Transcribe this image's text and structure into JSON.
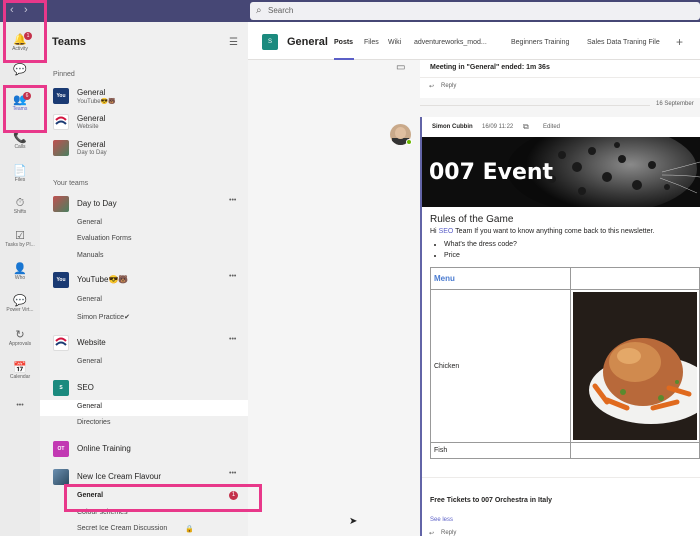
{
  "titlebar": {
    "search_placeholder": "Search",
    "back_glyph": "‹",
    "forward_glyph": "›"
  },
  "rail": [
    {
      "label": "Activity",
      "icon": "bell-icon",
      "glyph": "🔔",
      "badge": "1"
    },
    {
      "label": "",
      "icon": "chat-icon",
      "glyph": "💬"
    },
    {
      "label": "Teams",
      "icon": "teams-icon",
      "glyph": "👥",
      "badge": "6"
    },
    {
      "label": "Calls",
      "icon": "phone-icon",
      "glyph": "📞"
    },
    {
      "label": "Files",
      "icon": "file-icon",
      "glyph": "📄"
    },
    {
      "label": "Shifts",
      "icon": "clock-icon",
      "glyph": "⏱"
    },
    {
      "label": "Tasks by Pl...",
      "icon": "tasks-icon",
      "glyph": "☑"
    },
    {
      "label": "Who",
      "icon": "who-icon",
      "glyph": "👤"
    },
    {
      "label": "Power Virt...",
      "icon": "power-virtual-icon",
      "glyph": "💬"
    },
    {
      "label": "Approvals",
      "icon": "approvals-icon",
      "glyph": "↻"
    },
    {
      "label": "Calendar",
      "icon": "calendar-icon",
      "glyph": "📅"
    },
    {
      "label": "",
      "icon": "more-apps-icon",
      "glyph": "•••"
    }
  ],
  "panel": {
    "title": "Teams",
    "pinned_label": "Pinned",
    "your_teams_label": "Your teams",
    "more_glyph": "•••",
    "pinned": [
      {
        "name": "General",
        "sub": "YouTube😎🐻"
      },
      {
        "name": "General",
        "sub": "Website"
      },
      {
        "name": "General",
        "sub": "Day to Day"
      }
    ],
    "teams": [
      {
        "name": "Day to Day",
        "channels": [
          "General",
          "Evaluation Forms",
          "Manuals"
        ]
      },
      {
        "name": "YouTube😎🐻",
        "channels": [
          "General",
          "Simon Practice✔"
        ]
      },
      {
        "name": "Website",
        "channels": [
          "General"
        ]
      },
      {
        "name": "SEO",
        "avatar": "S",
        "channels": [
          "General",
          "Directories"
        ]
      },
      {
        "name": "Online Training",
        "avatar": "OT",
        "channels": []
      },
      {
        "name": "New Ice Cream Flavour",
        "channels": [
          "General",
          "Colour schemes",
          "Secret Ice Cream Discussion"
        ],
        "badge": "1"
      }
    ]
  },
  "main": {
    "channel_avatar": "S",
    "channel_name": "General",
    "tabs": [
      "Posts",
      "Files",
      "Wiki",
      "adventureworks_mod...",
      "Beginners Training",
      "Sales Data Traning File"
    ],
    "add_tab": "+",
    "meeting_text": "Meeting in \"General\" ended: 1m 36s",
    "reply_label": "Reply",
    "date_label": "16 September",
    "post": {
      "author": "Simon Cubbin",
      "time": "16/09 11:22",
      "edited": "Edited",
      "banner_title": "007 Event",
      "rules_title": "Rules of the Game",
      "hi_prefix": "Hi ",
      "hi_link": "SEO",
      "hi_text": " Team If you want to know anything come back to this newsletter.",
      "bullets": [
        "What's the dress code?",
        "Price"
      ],
      "menu_header": "Menu",
      "rows": [
        "Chicken",
        "Fish"
      ],
      "tickets": "Free Tickets to 007 Orchestra in Italy",
      "see_less": "See less"
    }
  }
}
